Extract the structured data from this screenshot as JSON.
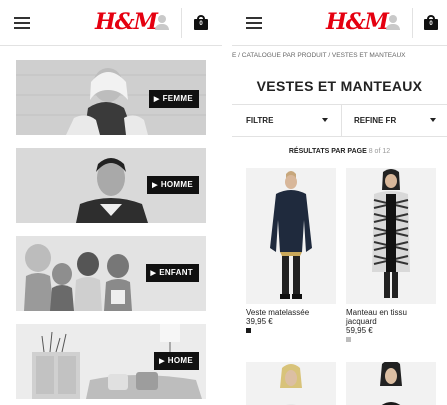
{
  "left_screen": {
    "header": {
      "logo": "H&M",
      "bag_count": "0"
    },
    "categories": [
      {
        "label": "FEMME"
      },
      {
        "label": "HOMME"
      },
      {
        "label": "ENFANT"
      },
      {
        "label": "HOME"
      }
    ]
  },
  "right_screen": {
    "header": {
      "logo": "H&M",
      "bag_count": "0"
    },
    "breadcrumb": "E / CATALOGUE PAR PRODUIT / VESTES ET MANTEAUX",
    "page_title": "VESTES ET MANTEAUX",
    "filter_label": "FILTRE",
    "refine_label": "REFINE FR",
    "results": {
      "label": "RÉSULTATS PAR PAGE",
      "pager": "8 of 12"
    },
    "products": [
      {
        "name": "Veste matelassée",
        "price": "39,95 €",
        "swatch_color": "#1a1a1a"
      },
      {
        "name": "Manteau en tissu jacquard",
        "price": "59,95 €",
        "swatch_color": "#bdbdbd"
      }
    ]
  },
  "colors": {
    "brand_red": "#e50010",
    "label_bg": "#111111"
  }
}
